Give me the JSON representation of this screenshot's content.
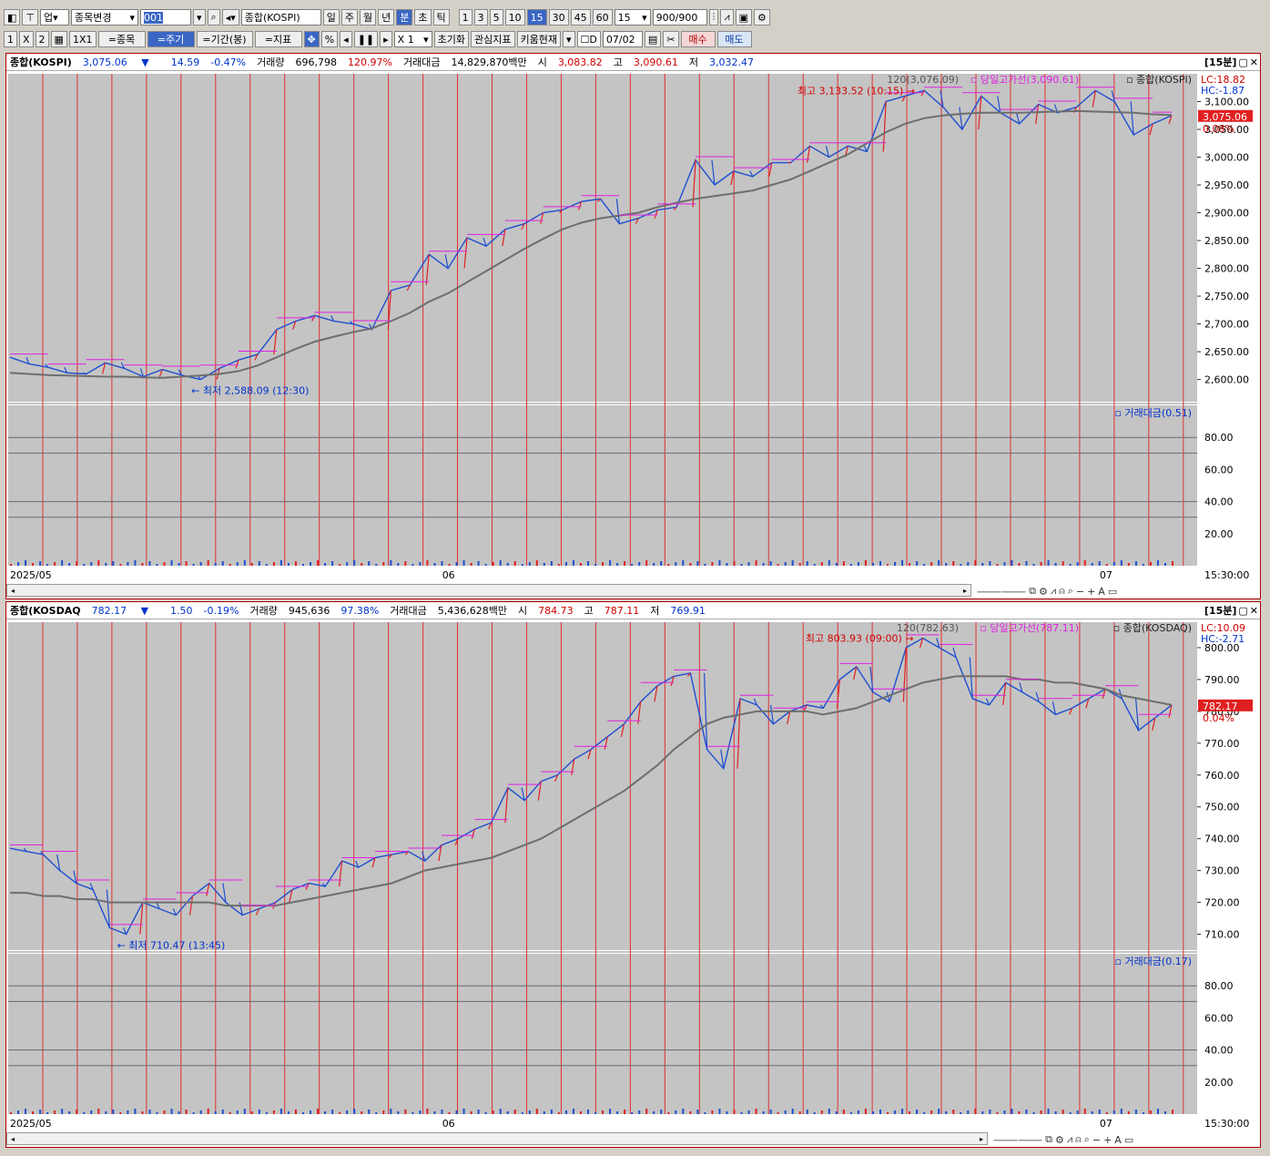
{
  "toolbar1": {
    "market_select": "업",
    "change_label": "종목변경",
    "code_value": "001",
    "name_value": "종합(KOSPI)",
    "period_buttons": [
      "일",
      "주",
      "월",
      "년",
      "분",
      "초",
      "틱"
    ],
    "minute_buttons": [
      "1",
      "3",
      "5",
      "10",
      "15",
      "30",
      "45",
      "60"
    ],
    "minute_select": "15",
    "count_value": "900",
    "count_total": "/900"
  },
  "toolbar2": {
    "layout_1": "1",
    "layout_x": "X",
    "layout_2": "2",
    "grid_1x1": "1X1",
    "stock_btn": "=종목",
    "period_btn": "=주기",
    "range_btn": "=기간(봉)",
    "indicator_btn": "=지표",
    "percent_btn": "%",
    "zoom_value": "X 1",
    "reset_btn": "초기화",
    "interest_btn": "관심지표",
    "kiwoom_btn": "키움현재",
    "date_check": "D",
    "date_value": "07/02",
    "buy_btn": "매수",
    "sell_btn": "매도"
  },
  "panels": [
    {
      "name": "종합(KOSPI)",
      "price": "3,075.06",
      "arrow": "▼",
      "change": "14.59",
      "pct": "-0.47%",
      "vol_label": "거래량",
      "vol": "696,798",
      "vol_pct": "120.97%",
      "amt_label": "거래대금",
      "amt": "14,829,870백만",
      "open_label": "시",
      "open": "3,083.82",
      "high_label": "고",
      "high": "3,090.61",
      "low_label": "저",
      "low": "3,032.47",
      "interval": "[15분]",
      "legend_ma": "120(3,076.09)",
      "legend_line": "당일고가선(3,090.61)",
      "legend_name": "종합(KOSPI)",
      "lc": "LC:18.82",
      "hc": "HC:-1.87",
      "cur_tag": "3,075.06",
      "cur_pct": "0.08%",
      "max_label": "최고 3,133.52 (10:15)",
      "min_label": "최저 2,588.09 (12:30)",
      "y_ticks": [
        "3,100.00",
        "3,050.00",
        "3,000.00",
        "2,950.00",
        "2,900.00",
        "2,850.00",
        "2,800.00",
        "2,750.00",
        "2,700.00",
        "2,650.00",
        "2,600.00"
      ],
      "sub_legend": "거래대금(0.51)",
      "sub_ticks": [
        "80.00",
        "60.00",
        "40.00",
        "20.00"
      ],
      "x_labels": [
        "2025/05",
        "06",
        "07"
      ],
      "x_time": "15:30:00"
    },
    {
      "name": "종합(KOSDAQ",
      "price": "782.17",
      "arrow": "▼",
      "change": "1.50",
      "pct": "-0.19%",
      "vol_label": "거래량",
      "vol": "945,636",
      "vol_pct": "97.38%",
      "amt_label": "거래대금",
      "amt": "5,436,628백만",
      "open_label": "시",
      "open": "784.73",
      "high_label": "고",
      "high": "787.11",
      "low_label": "저",
      "low": "769.91",
      "interval": "[15분]",
      "legend_ma": "120(782.63)",
      "legend_line": "당일고가선(787.11)",
      "legend_name": "종합(KOSDAQ)",
      "lc": "LC:10.09",
      "hc": "HC:-2.71",
      "cur_tag": "782.17",
      "cur_pct": "0.04%",
      "max_label": "최고 803.93 (09:00)",
      "min_label": "최저 710.47 (13:45)",
      "y_ticks": [
        "800.00",
        "790.00",
        "780.00",
        "770.00",
        "760.00",
        "750.00",
        "740.00",
        "730.00",
        "720.00",
        "710.00"
      ],
      "sub_legend": "거래대금(0.17)",
      "sub_ticks": [
        "80.00",
        "60.00",
        "40.00",
        "20.00"
      ],
      "x_labels": [
        "2025/05",
        "06",
        "07"
      ],
      "x_time": "15:30:00"
    }
  ],
  "chart_data": [
    {
      "type": "line",
      "x_labels": [
        "2025/05",
        "06",
        "07"
      ],
      "ylim": [
        2560,
        3150
      ],
      "series": [
        {
          "values": [
            2640,
            2628,
            2622,
            2612,
            2610,
            2630,
            2620,
            2605,
            2618,
            2608,
            2600,
            2620,
            2635,
            2645,
            2690,
            2705,
            2715,
            2705,
            2700,
            2690,
            2760,
            2770,
            2825,
            2800,
            2855,
            2840,
            2870,
            2880,
            2900,
            2905,
            2920,
            2925,
            2880,
            2890,
            2905,
            2910,
            2995,
            2950,
            2975,
            2965,
            2990,
            2990,
            3020,
            3000,
            3020,
            3010,
            3100,
            3110,
            3120,
            3090,
            3050,
            3110,
            3080,
            3060,
            3095,
            3080,
            3090,
            3120,
            3100,
            3040,
            3060,
            3075
          ]
        },
        {
          "values": [
            2612,
            2610,
            2608,
            2607,
            2606,
            2605,
            2605,
            2604,
            2603,
            2605,
            2607,
            2610,
            2615,
            2625,
            2640,
            2655,
            2668,
            2677,
            2685,
            2692,
            2705,
            2720,
            2740,
            2755,
            2775,
            2795,
            2815,
            2835,
            2853,
            2870,
            2882,
            2890,
            2895,
            2900,
            2910,
            2918,
            2925,
            2930,
            2935,
            2940,
            2950,
            2960,
            2975,
            2990,
            3005,
            3025,
            3045,
            3060,
            3070,
            3075,
            3078,
            3080,
            3080,
            3080,
            3081,
            3082,
            3083,
            3082,
            3081,
            3080,
            3077,
            3076
          ]
        }
      ]
    },
    {
      "type": "line",
      "x_labels": [
        "2025/05",
        "06",
        "07"
      ],
      "ylim": [
        705,
        808
      ],
      "series": [
        {
          "values": [
            737,
            736,
            735,
            730,
            726,
            724,
            712,
            710,
            720,
            718,
            716,
            722,
            726,
            720,
            716,
            718,
            720,
            724,
            726,
            725,
            733,
            731,
            734,
            735,
            736,
            733,
            738,
            740,
            743,
            745,
            756,
            752,
            758,
            760,
            765,
            768,
            772,
            776,
            783,
            788,
            791,
            792,
            768,
            762,
            784,
            782,
            776,
            780,
            782,
            781,
            790,
            794,
            786,
            783,
            800,
            803,
            800,
            797,
            784,
            782,
            789,
            786,
            783,
            779,
            781,
            784,
            787,
            784,
            774,
            778,
            782
          ]
        },
        {
          "values": [
            723,
            723,
            722,
            722,
            721,
            721,
            720,
            720,
            720,
            720,
            720,
            720,
            720,
            719,
            719,
            719,
            719,
            720,
            721,
            722,
            723,
            724,
            725,
            726,
            728,
            730,
            731,
            732,
            733,
            734,
            736,
            738,
            740,
            743,
            746,
            749,
            752,
            755,
            759,
            763,
            768,
            772,
            776,
            778,
            779,
            780,
            780,
            780,
            780,
            779,
            780,
            781,
            783,
            785,
            787,
            789,
            790,
            791,
            791,
            791,
            791,
            790,
            790,
            789,
            789,
            788,
            787,
            785,
            784,
            783,
            782
          ]
        }
      ]
    }
  ]
}
